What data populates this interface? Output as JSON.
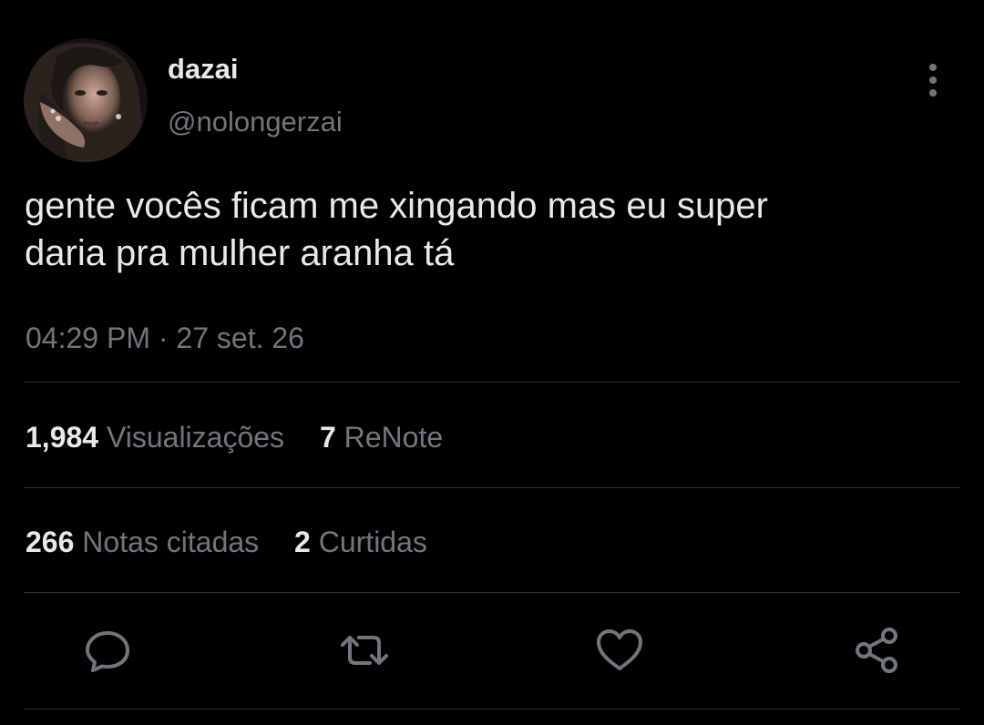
{
  "tweet": {
    "display_name": "dazai",
    "handle": "@nolongerzai",
    "text": "gente vocês ficam me xingando mas eu super\ndaria pra mulher aranha tá",
    "time": "04:29 PM",
    "separator": "·",
    "date": "27 set. 26"
  },
  "stats": {
    "views": {
      "count": "1,984",
      "label": "Visualizações"
    },
    "renotes": {
      "count": "7",
      "label": "ReNote"
    },
    "quotes": {
      "count": "266",
      "label": "Notas citadas"
    },
    "likes": {
      "count": "2",
      "label": "Curtidas"
    }
  },
  "icons": {
    "more": "more-vertical-icon",
    "reply": "reply-bubble-icon",
    "renote": "renote-arrows-icon",
    "like": "heart-icon",
    "share": "share-nodes-icon"
  },
  "colors": {
    "background": "#000000",
    "text_primary": "#e7e9ea",
    "text_secondary": "#71767b",
    "divider": "#2f3336"
  }
}
